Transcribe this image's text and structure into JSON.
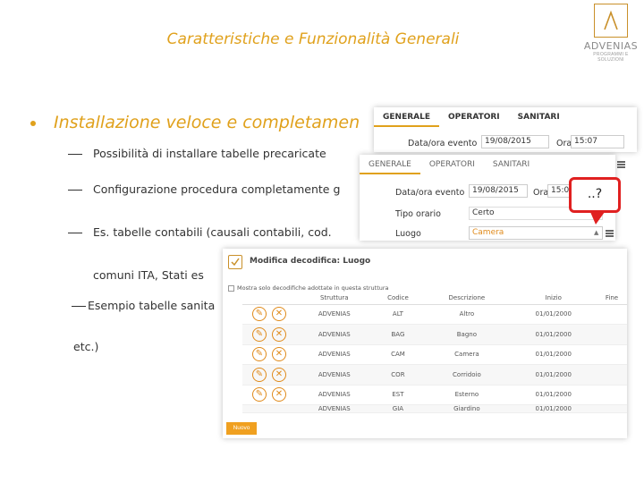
{
  "slide": {
    "title": "Caratteristiche e Funzionalità Generali",
    "bullet": "Installazione veloce e completamen",
    "sub1": "Possibilità di installare tabelle precaricate",
    "sub2": "Configurazione procedura completamente g",
    "sub3a": "Es. tabelle contabili (causali contabili, cod.",
    "sub3b": "comuni ITA, Stati es",
    "sub4": "Esempio tabelle sanita",
    "sub5": "etc.)"
  },
  "logo": {
    "name": "ADVENIAS",
    "tagline": "PROGRAMMI E SOLUZIONI"
  },
  "panel1": {
    "tabs": [
      "GENERALE",
      "OPERATORI",
      "SANITARI"
    ],
    "date_label": "Data/ora evento",
    "date_value": "19/08/2015",
    "time_label": "Ora",
    "time_value": "15:07"
  },
  "panel2": {
    "tabs": [
      "GENERALE",
      "OPERATORI",
      "SANITARI"
    ],
    "date_label": "Data/ora evento",
    "date_value": "19/08/2015",
    "time_label": "Ora",
    "time_value": "15:0",
    "tipo_label": "Tipo orario",
    "tipo_value": "Certo",
    "luogo_label": "Luogo",
    "luogo_value": "Camera"
  },
  "bubble": {
    "text": "..?"
  },
  "dialog": {
    "title": "Modifica decodifica: Luogo",
    "checkbox_label": "Mostra solo decodifiche adottate in questa struttura",
    "columns": [
      "Struttura",
      "Codice",
      "Descrizione",
      "Inizio",
      "Fine"
    ],
    "rows": [
      {
        "struttura": "ADVENIAS",
        "codice": "ALT",
        "descrizione": "Altro",
        "inizio": "01/01/2000",
        "fine": ""
      },
      {
        "struttura": "ADVENIAS",
        "codice": "BAG",
        "descrizione": "Bagno",
        "inizio": "01/01/2000",
        "fine": ""
      },
      {
        "struttura": "ADVENIAS",
        "codice": "CAM",
        "descrizione": "Camera",
        "inizio": "01/01/2000",
        "fine": ""
      },
      {
        "struttura": "ADVENIAS",
        "codice": "COR",
        "descrizione": "Corridoio",
        "inizio": "01/01/2000",
        "fine": ""
      },
      {
        "struttura": "ADVENIAS",
        "codice": "EST",
        "descrizione": "Esterno",
        "inizio": "01/01/2000",
        "fine": ""
      },
      {
        "struttura": "ADVENIAS",
        "codice": "GIA",
        "descrizione": "Giardino",
        "inizio": "01/01/2000",
        "fine": ""
      }
    ],
    "new_button": "Nuovo"
  },
  "colors": {
    "accent": "#e0a11c",
    "alert": "#e02020",
    "button": "#f0a020"
  }
}
